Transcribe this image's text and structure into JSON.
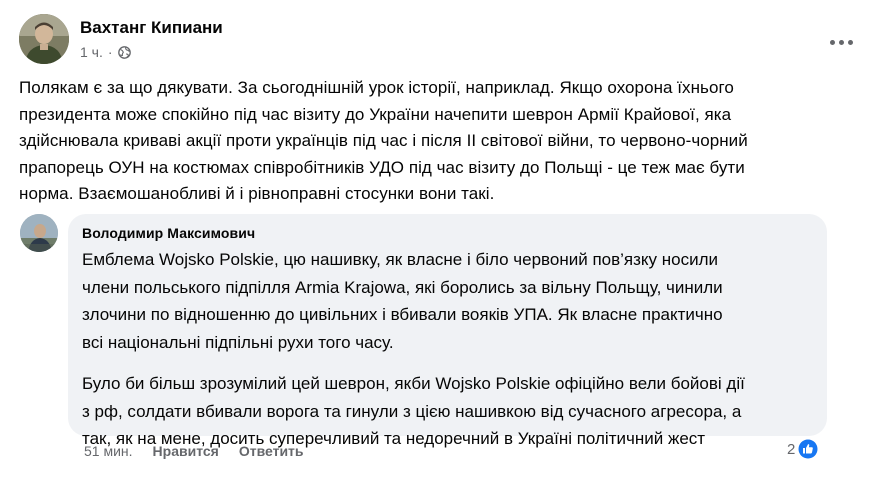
{
  "post": {
    "author": "Вахтанг Кипиани",
    "time": "1 ч.",
    "dot": "·",
    "text_lines": [
      "Полякам є за що дякувати. За сьогоднішній урок історії, наприклад. Якщо охорона їхнього",
      "президента може спокійно під час візиту до України начепити шеврон Армії Крайової, яка",
      "здійснювала криваві акції проти українців під час і після II світової війни, то червоно-чорний",
      "прапорець ОУН на костюмах співробітників УДО під час візиту до Польщі - це теж має бути",
      "норма. Взаємошанобливі й і рівноправні стосунки вони такі."
    ]
  },
  "comment": {
    "author": "Володимир Максимович",
    "paragraph1": [
      "Емблема Wojsko Polskie, цю нашивку, як власне і біло червоний пов’язку носили",
      "члени польського підпілля Armia Krajowa, які боролись за вільну Польщу, чинили",
      "злочини по відношенню до цивільних і вбивали вояків УПА. Як власне практично",
      "всі національні підпільні рухи того часу."
    ],
    "paragraph2": [
      "Було би більш зрозумілий цей шеврон, якби Wojsko Polskie офіційно вели бойові дії",
      "з рф, солдати вбивали ворога та гинули з цією нашивкою від сучасного агресора, а",
      "так, як на мене, досить суперечливий та недоречний в Україні політичний жест"
    ],
    "time": "51 мин.",
    "like_label": "Нравится",
    "reply_label": "Ответить",
    "reaction_count": "2"
  },
  "colors": {
    "facebook_blue": "#1877f2",
    "secondary_text": "#65676b",
    "bubble_bg": "#f0f2f5"
  },
  "icons": {
    "globe": "globe-icon",
    "more": "more-options-icon",
    "like": "like-reaction-icon"
  }
}
